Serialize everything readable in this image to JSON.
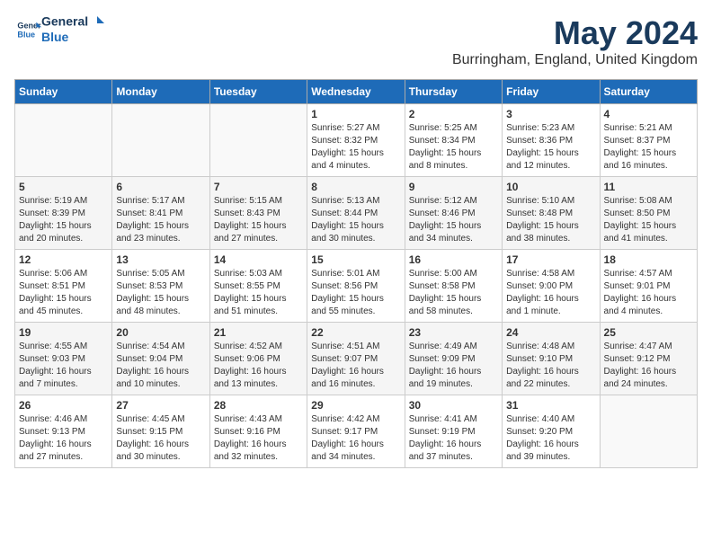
{
  "logo": {
    "general": "General",
    "blue": "Blue"
  },
  "header": {
    "month": "May 2024",
    "location": "Burringham, England, United Kingdom"
  },
  "weekdays": [
    "Sunday",
    "Monday",
    "Tuesday",
    "Wednesday",
    "Thursday",
    "Friday",
    "Saturday"
  ],
  "weeks": [
    [
      {
        "day": "",
        "info": ""
      },
      {
        "day": "",
        "info": ""
      },
      {
        "day": "",
        "info": ""
      },
      {
        "day": "1",
        "info": "Sunrise: 5:27 AM\nSunset: 8:32 PM\nDaylight: 15 hours and 4 minutes."
      },
      {
        "day": "2",
        "info": "Sunrise: 5:25 AM\nSunset: 8:34 PM\nDaylight: 15 hours and 8 minutes."
      },
      {
        "day": "3",
        "info": "Sunrise: 5:23 AM\nSunset: 8:36 PM\nDaylight: 15 hours and 12 minutes."
      },
      {
        "day": "4",
        "info": "Sunrise: 5:21 AM\nSunset: 8:37 PM\nDaylight: 15 hours and 16 minutes."
      }
    ],
    [
      {
        "day": "5",
        "info": "Sunrise: 5:19 AM\nSunset: 8:39 PM\nDaylight: 15 hours and 20 minutes."
      },
      {
        "day": "6",
        "info": "Sunrise: 5:17 AM\nSunset: 8:41 PM\nDaylight: 15 hours and 23 minutes."
      },
      {
        "day": "7",
        "info": "Sunrise: 5:15 AM\nSunset: 8:43 PM\nDaylight: 15 hours and 27 minutes."
      },
      {
        "day": "8",
        "info": "Sunrise: 5:13 AM\nSunset: 8:44 PM\nDaylight: 15 hours and 30 minutes."
      },
      {
        "day": "9",
        "info": "Sunrise: 5:12 AM\nSunset: 8:46 PM\nDaylight: 15 hours and 34 minutes."
      },
      {
        "day": "10",
        "info": "Sunrise: 5:10 AM\nSunset: 8:48 PM\nDaylight: 15 hours and 38 minutes."
      },
      {
        "day": "11",
        "info": "Sunrise: 5:08 AM\nSunset: 8:50 PM\nDaylight: 15 hours and 41 minutes."
      }
    ],
    [
      {
        "day": "12",
        "info": "Sunrise: 5:06 AM\nSunset: 8:51 PM\nDaylight: 15 hours and 45 minutes."
      },
      {
        "day": "13",
        "info": "Sunrise: 5:05 AM\nSunset: 8:53 PM\nDaylight: 15 hours and 48 minutes."
      },
      {
        "day": "14",
        "info": "Sunrise: 5:03 AM\nSunset: 8:55 PM\nDaylight: 15 hours and 51 minutes."
      },
      {
        "day": "15",
        "info": "Sunrise: 5:01 AM\nSunset: 8:56 PM\nDaylight: 15 hours and 55 minutes."
      },
      {
        "day": "16",
        "info": "Sunrise: 5:00 AM\nSunset: 8:58 PM\nDaylight: 15 hours and 58 minutes."
      },
      {
        "day": "17",
        "info": "Sunrise: 4:58 AM\nSunset: 9:00 PM\nDaylight: 16 hours and 1 minute."
      },
      {
        "day": "18",
        "info": "Sunrise: 4:57 AM\nSunset: 9:01 PM\nDaylight: 16 hours and 4 minutes."
      }
    ],
    [
      {
        "day": "19",
        "info": "Sunrise: 4:55 AM\nSunset: 9:03 PM\nDaylight: 16 hours and 7 minutes."
      },
      {
        "day": "20",
        "info": "Sunrise: 4:54 AM\nSunset: 9:04 PM\nDaylight: 16 hours and 10 minutes."
      },
      {
        "day": "21",
        "info": "Sunrise: 4:52 AM\nSunset: 9:06 PM\nDaylight: 16 hours and 13 minutes."
      },
      {
        "day": "22",
        "info": "Sunrise: 4:51 AM\nSunset: 9:07 PM\nDaylight: 16 hours and 16 minutes."
      },
      {
        "day": "23",
        "info": "Sunrise: 4:49 AM\nSunset: 9:09 PM\nDaylight: 16 hours and 19 minutes."
      },
      {
        "day": "24",
        "info": "Sunrise: 4:48 AM\nSunset: 9:10 PM\nDaylight: 16 hours and 22 minutes."
      },
      {
        "day": "25",
        "info": "Sunrise: 4:47 AM\nSunset: 9:12 PM\nDaylight: 16 hours and 24 minutes."
      }
    ],
    [
      {
        "day": "26",
        "info": "Sunrise: 4:46 AM\nSunset: 9:13 PM\nDaylight: 16 hours and 27 minutes."
      },
      {
        "day": "27",
        "info": "Sunrise: 4:45 AM\nSunset: 9:15 PM\nDaylight: 16 hours and 30 minutes."
      },
      {
        "day": "28",
        "info": "Sunrise: 4:43 AM\nSunset: 9:16 PM\nDaylight: 16 hours and 32 minutes."
      },
      {
        "day": "29",
        "info": "Sunrise: 4:42 AM\nSunset: 9:17 PM\nDaylight: 16 hours and 34 minutes."
      },
      {
        "day": "30",
        "info": "Sunrise: 4:41 AM\nSunset: 9:19 PM\nDaylight: 16 hours and 37 minutes."
      },
      {
        "day": "31",
        "info": "Sunrise: 4:40 AM\nSunset: 9:20 PM\nDaylight: 16 hours and 39 minutes."
      },
      {
        "day": "",
        "info": ""
      }
    ]
  ]
}
